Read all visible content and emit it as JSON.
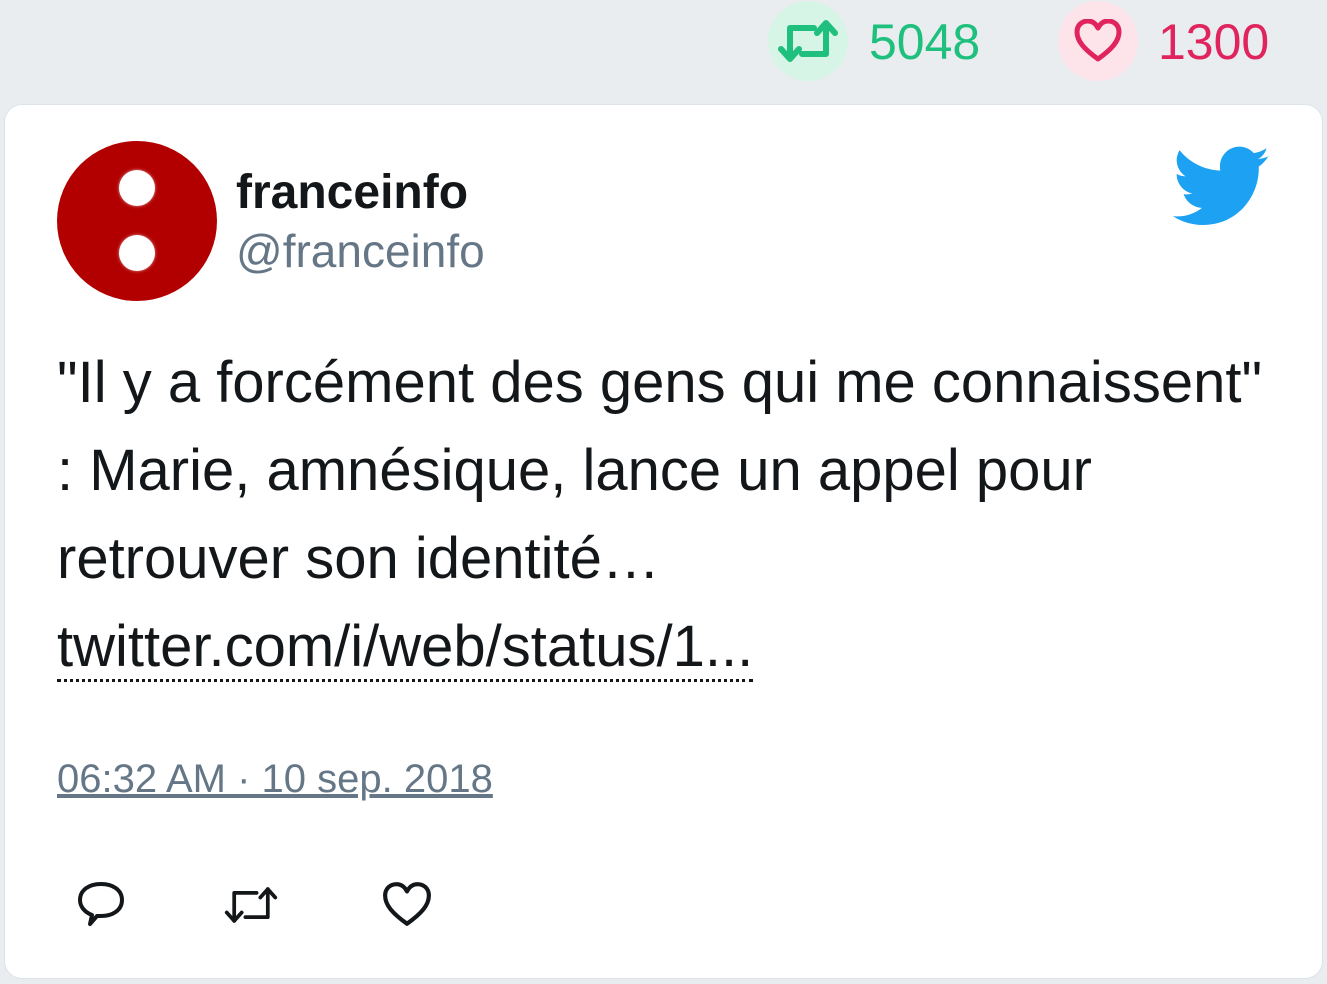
{
  "stats": {
    "retweets": "5048",
    "likes": "1300",
    "retweet_color": "#1fc07d",
    "like_color": "#e0245e"
  },
  "tweet": {
    "author_name": "franceinfo",
    "author_handle": "@franceinfo",
    "text": "\"Il y a forcément des gens qui me connaissent\" : Marie, amnésique, lance un appel pour retrouver son identité…",
    "link_text": "twitter.com/i/web/status/1...",
    "timestamp": "06:32 AM · 10 sep. 2018"
  },
  "icons": {
    "retweet": "retweet-icon",
    "like": "heart-icon",
    "reply": "reply-icon",
    "brand": "twitter-bird-icon",
    "brand_color": "#1da1f2",
    "avatar_color": "#b20000"
  }
}
